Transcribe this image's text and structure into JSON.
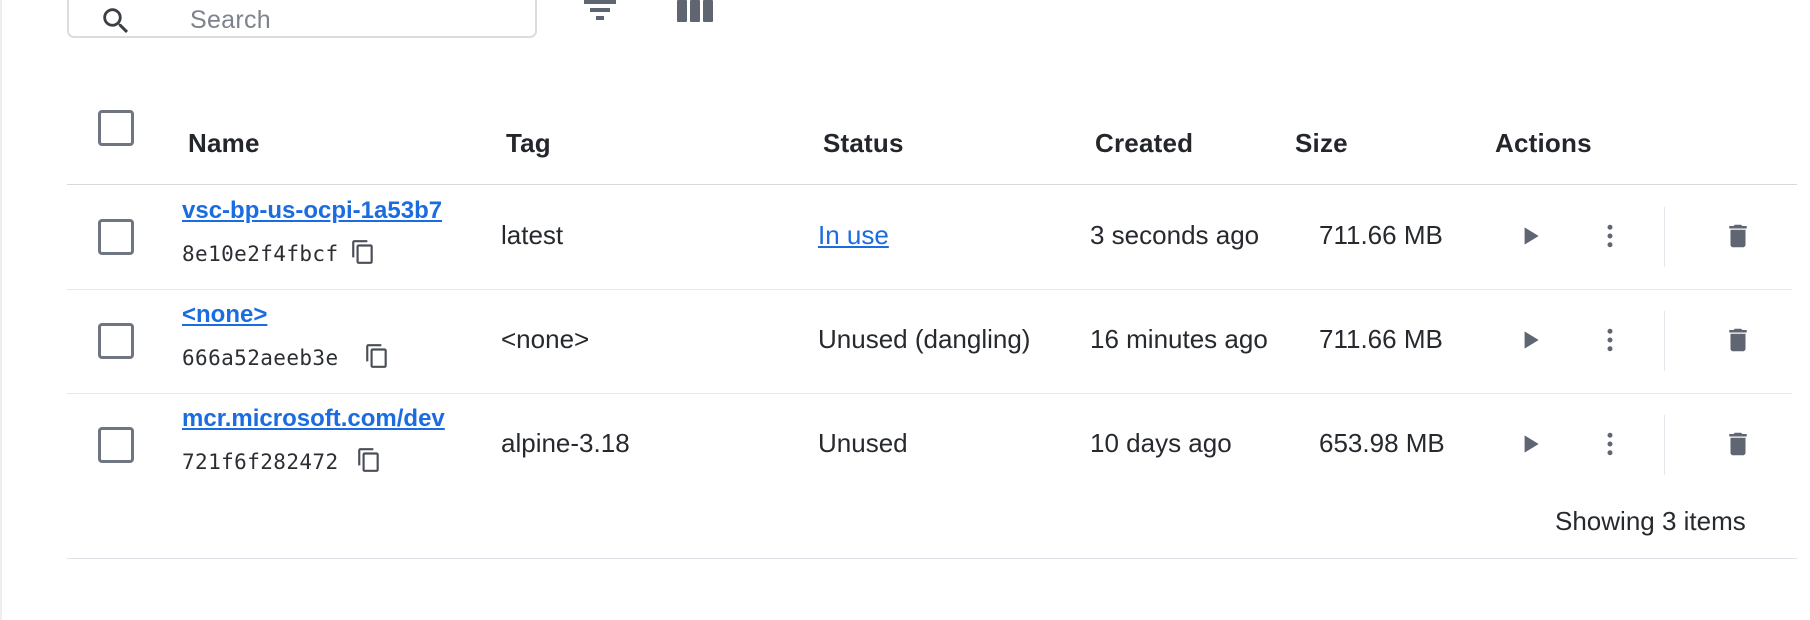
{
  "search": {
    "placeholder": "Search"
  },
  "table": {
    "columns": {
      "name": "Name",
      "tag": "Tag",
      "status": "Status",
      "created": "Created",
      "size": "Size",
      "actions": "Actions"
    },
    "rows": [
      {
        "name": "vsc-bp-us-ocpi-1a53b7",
        "id": "8e10e2f4fbcf",
        "tag": "latest",
        "status": "In use",
        "created": "3 seconds ago",
        "size": "711.66 MB"
      },
      {
        "name": "<none>",
        "id": "666a52aeeb3e",
        "tag": "<none>",
        "status": "Unused (dangling)",
        "created": "16 minutes ago",
        "size": "711.66 MB"
      },
      {
        "name": "mcr.microsoft.com/dev",
        "id": "721f6f282472",
        "tag": "alpine-3.18",
        "status": "Unused",
        "created": "10 days ago",
        "size": "653.98 MB"
      }
    ]
  },
  "footer": {
    "summary": "Showing 3 items"
  },
  "colors": {
    "link": "#1a6ce0",
    "icon": "#5f6672",
    "border": "#d9dce1"
  }
}
